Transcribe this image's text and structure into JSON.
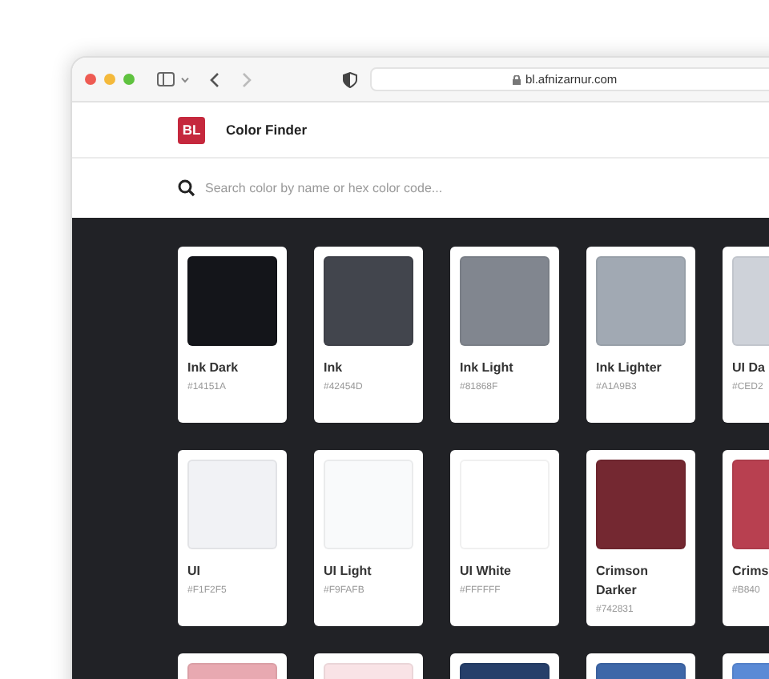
{
  "browser": {
    "url": "bl.afnizarnur.com"
  },
  "header": {
    "logo": "BL",
    "title": "Color Finder"
  },
  "search": {
    "placeholder": "Search color by name or hex color code..."
  },
  "rows": [
    [
      {
        "name": "Ink Dark",
        "hex": "#14151A",
        "color": "#14151a"
      },
      {
        "name": "Ink",
        "hex": "#42454D",
        "color": "#42454d"
      },
      {
        "name": "Ink Light",
        "hex": "#81868F",
        "color": "#81868f"
      },
      {
        "name": "Ink Lighter",
        "hex": "#A1A9B3",
        "color": "#a1a9b3"
      },
      {
        "name": "UI Da",
        "hex": "#CED2",
        "color": "#ced2d9"
      }
    ],
    [
      {
        "name": "UI",
        "hex": "#F1F2F5",
        "color": "#f1f2f5"
      },
      {
        "name": "UI Light",
        "hex": "#F9FAFB",
        "color": "#f9fafb"
      },
      {
        "name": "UI White",
        "hex": "#FFFFFF",
        "color": "#ffffff"
      },
      {
        "name": "Crimson Darker",
        "hex": "#742831",
        "color": "#742831"
      },
      {
        "name": "Crims",
        "hex": "#B840",
        "color": "#b84050"
      }
    ],
    [
      {
        "color": "#e8a9b1"
      },
      {
        "color": "#f9e3e6"
      },
      {
        "color": "#263f6a"
      },
      {
        "color": "#3e67a8"
      },
      {
        "color": "#5a8ad6"
      }
    ]
  ]
}
